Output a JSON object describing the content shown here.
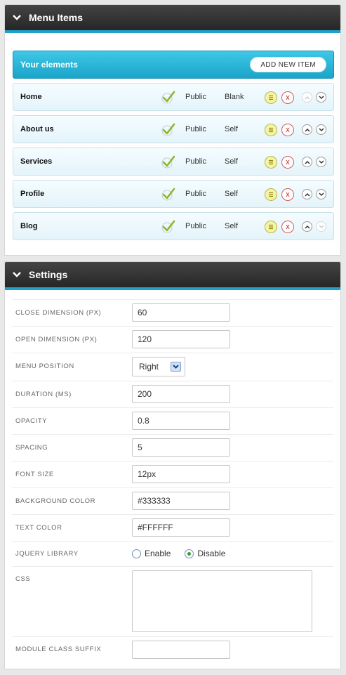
{
  "menu_panel": {
    "title": "Menu Items",
    "elements_title": "Your elements",
    "add_button": "ADD NEW ITEM",
    "items": [
      {
        "name": "Home",
        "access": "Public",
        "target": "Blank",
        "up_enabled": false,
        "down_enabled": true
      },
      {
        "name": "About us",
        "access": "Public",
        "target": "Self",
        "up_enabled": true,
        "down_enabled": true
      },
      {
        "name": "Services",
        "access": "Public",
        "target": "Self",
        "up_enabled": true,
        "down_enabled": true
      },
      {
        "name": "Profile",
        "access": "Public",
        "target": "Self",
        "up_enabled": true,
        "down_enabled": true
      },
      {
        "name": "Blog",
        "access": "Public",
        "target": "Self",
        "up_enabled": true,
        "down_enabled": false
      }
    ],
    "delete_glyph": "x"
  },
  "settings_panel": {
    "title": "Settings",
    "close_dimension": {
      "label": "CLOSE DIMENSION (PX)",
      "value": "60"
    },
    "open_dimension": {
      "label": "OPEN DIMENSION (PX)",
      "value": "120"
    },
    "menu_position": {
      "label": "MENU POSITION",
      "value": "Right"
    },
    "duration": {
      "label": "DURATION (MS)",
      "value": "200"
    },
    "opacity": {
      "label": "OPACITY",
      "value": "0.8"
    },
    "spacing": {
      "label": "SPACING",
      "value": "5"
    },
    "font_size": {
      "label": "FONT SIZE",
      "value": "12px"
    },
    "background_color": {
      "label": "BACKGROUND COLOR",
      "value": "#333333"
    },
    "text_color": {
      "label": "TEXT COLOR",
      "value": "#FFFFFF"
    },
    "jquery_library": {
      "label": "JQUERY LIBRARY",
      "enable_label": "Enable",
      "disable_label": "Disable",
      "selected": "Disable"
    },
    "css": {
      "label": "CSS",
      "value": ""
    },
    "module_class_suffix": {
      "label": "MODULE CLASS SUFFIX",
      "value": ""
    }
  },
  "colors": {
    "header_bg": "#333333",
    "header_accent": "#1ea0c8",
    "elements_bar": "#2bb5d9",
    "check_green": "#8ab82a",
    "delete_red": "#d02020"
  },
  "icons": {
    "header": "chevron-down-icon",
    "status": "checkmark-icon",
    "edit": "edit-icon",
    "delete": "delete-icon",
    "move_up": "arrow-up-icon",
    "move_down": "arrow-down-icon"
  }
}
